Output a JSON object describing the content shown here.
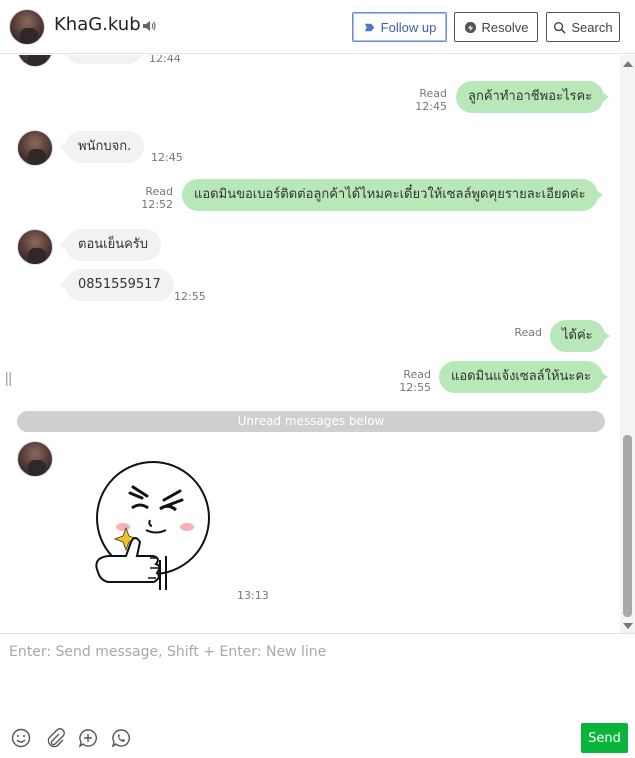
{
  "header": {
    "contact_name": "KhaG.kub",
    "follow_up_label": "Follow up",
    "resolve_label": "Resolve",
    "search_label": "Search",
    "speaker_icon": "speaker-icon"
  },
  "messages": {
    "m0_time": "12:44",
    "m1_text": "ลูกค้าทำอาชีพอะไรคะ",
    "m1_status": "Read",
    "m1_time": "12:45",
    "m2_text": "พนักบจก.",
    "m2_time": "12:45",
    "m3_text": "แอดมินขอเบอร์ติดต่อลูกค้าได้ไหมคะเดี๋ยวให้เซลล์พูดคุยรายละเอียดค่ะ",
    "m3_status": "Read",
    "m3_time": "12:52",
    "m4_text": "ตอนเย็นครับ",
    "m5_text": "0851559517",
    "m5_time": "12:55",
    "m6_text": "ได้ค่ะ",
    "m6_status": "Read",
    "m7_text": "แอดมินแจ้งเซลล์ให้นะคะ",
    "m7_status": "Read",
    "m7_time": "12:55",
    "unread_divider": "Unread messages below",
    "sticker_time": "13:13"
  },
  "composer": {
    "placeholder": "Enter: Send message, Shift + Enter: New line",
    "send_label": "Send"
  },
  "colors": {
    "outgoing_bubble": "#b9e8b8",
    "incoming_bubble": "#f1f2f4",
    "send_button": "#08b53a",
    "follow_up_accent": "#6a8fd1"
  }
}
